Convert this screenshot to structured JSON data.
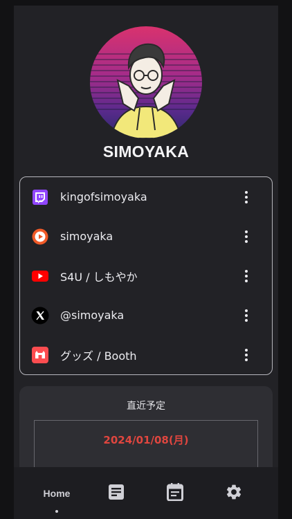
{
  "profile": {
    "name": "SIMOYAKA"
  },
  "links": [
    {
      "label": "kingofsimoyaka",
      "icon": "twitch-icon",
      "color": "#9146ff"
    },
    {
      "label": "simoyaka",
      "icon": "stream-play-icon",
      "color": "#f05a28"
    },
    {
      "label": "S4U / しもやか",
      "icon": "youtube-icon",
      "color": "#ff0000"
    },
    {
      "label": "@simoyaka",
      "icon": "x-logo-icon",
      "color": "#000000"
    },
    {
      "label": "グッズ / Booth",
      "icon": "booth-icon",
      "color": "#fc4d50"
    }
  ],
  "schedule": {
    "title": "直近予定",
    "date": "2024/01/08(月)"
  },
  "nav": {
    "home_label": "Home",
    "items": [
      "home",
      "article-icon",
      "calendar-icon",
      "gear-icon"
    ]
  }
}
